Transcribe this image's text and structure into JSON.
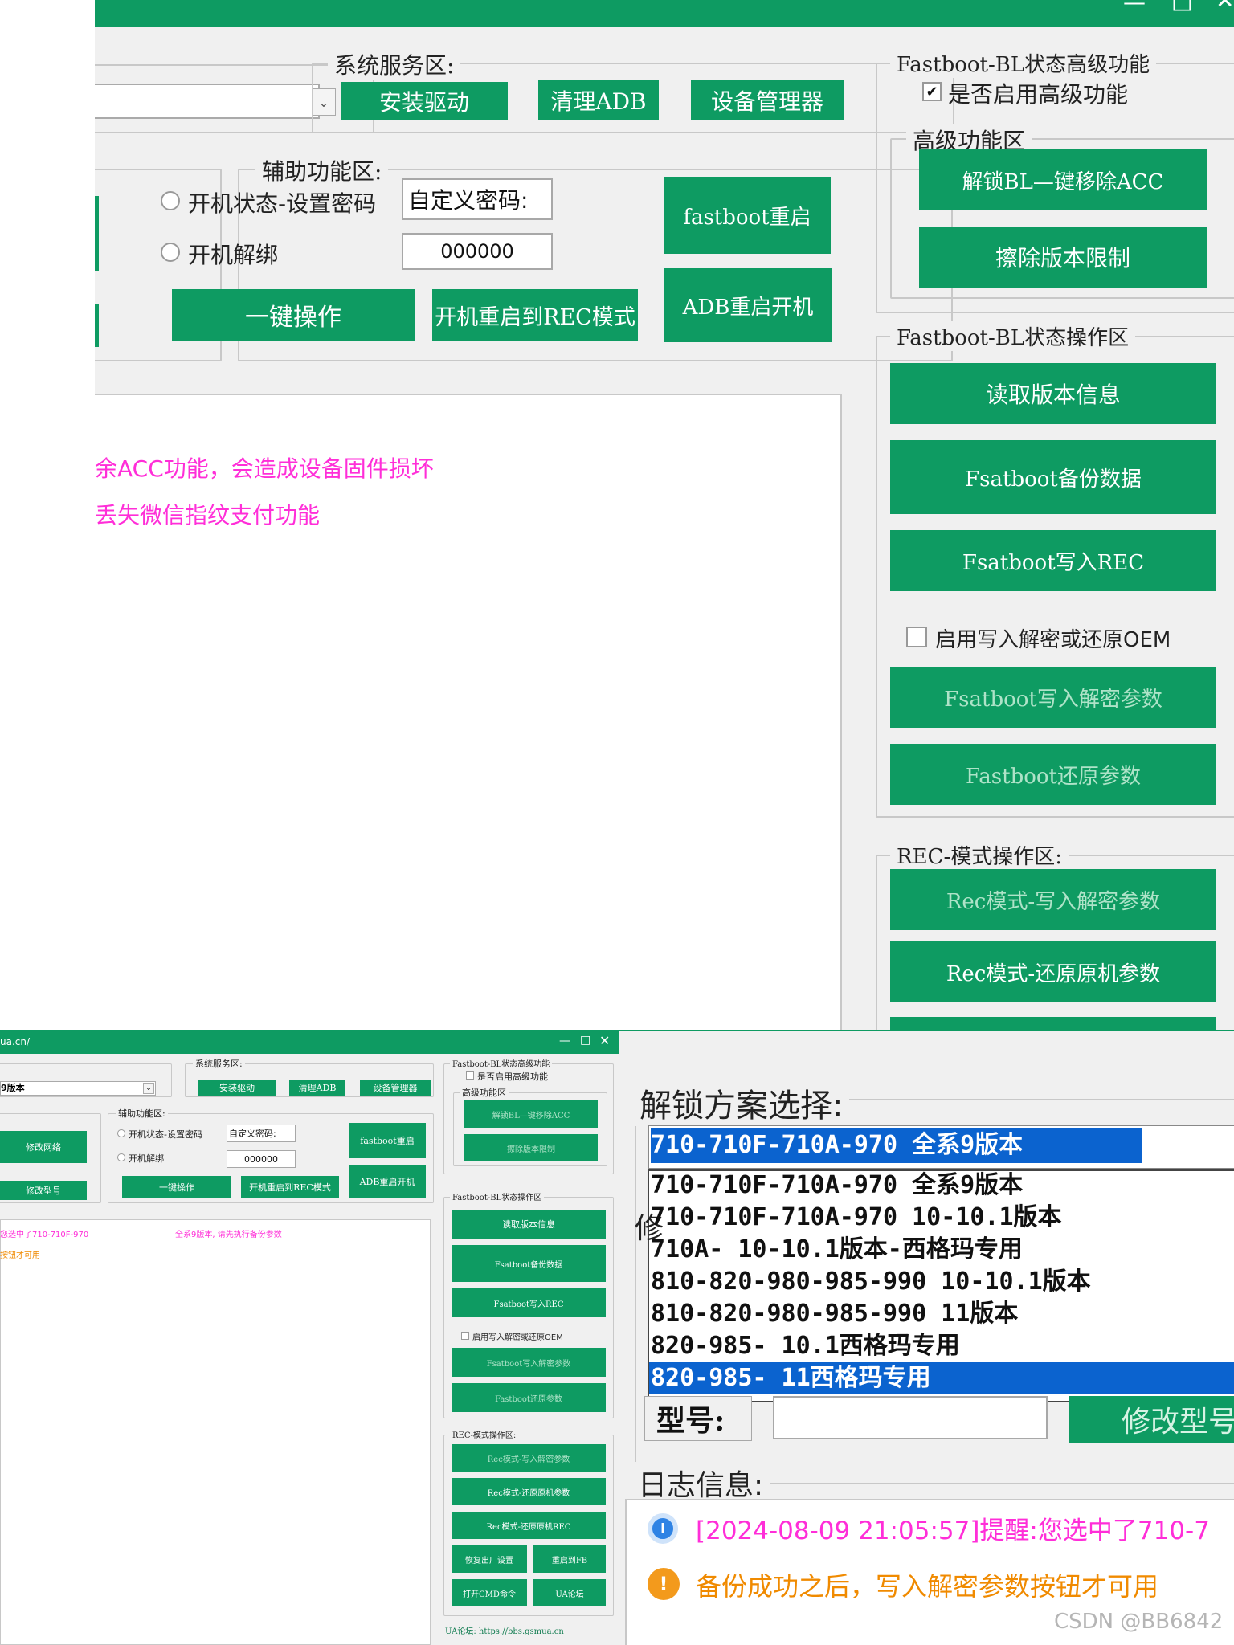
{
  "top": {
    "window_controls": {
      "minimize": "—",
      "maximize": "□",
      "close": "✕"
    },
    "system": {
      "legend": "系统服务区:",
      "install_driver": "安装驱动",
      "clear_adb": "清理ADB",
      "device_manager": "设备管理器"
    },
    "assist": {
      "legend": "辅助功能区:",
      "radio_set_pwd": "开机状态-设置密码",
      "custom_pwd_label": "自定义密码:",
      "radio_unbind": "开机解绑",
      "pwd_value": "000000",
      "one_key": "一键操作",
      "reboot_rec": "开机重启到REC模式",
      "fastboot_reboot": "fastboot重启",
      "adb_reboot": "ADB重启开机"
    },
    "advanced": {
      "legend": "Fastboot-BL状态高级功能",
      "enable_label": "是否启用高级功能",
      "checkmark": "✔",
      "sub_legend": "高级功能区",
      "unlock_acc": "解锁BL—键移除ACC",
      "erase_limit": "擦除版本限制"
    },
    "fastboot_ops": {
      "legend": "Fastboot-BL状态操作区",
      "read_version": "读取版本信息",
      "backup": "Fsatboot备份数据",
      "write_rec": "Fsatboot写入REC",
      "enable_write_label": "启用写入解密或还原OEM",
      "write_decrypt": "Fsatboot写入解密参数",
      "restore_params": "Fastboot还原参数"
    },
    "rec_ops": {
      "legend": "REC-模式操作区:",
      "write_decrypt": "Rec模式-写入解密参数",
      "restore_params": "Rec模式-还原原机参数"
    },
    "log": {
      "line1": "余ACC功能，会造成设备固件损坏",
      "line2": "丢失微信指纹支付功能"
    }
  },
  "small": {
    "url": "ua.cn/",
    "window_controls": {
      "minimize": "—",
      "maximize": "□",
      "close": "✕"
    },
    "version_select": "9版本",
    "modify_network": "修改网络",
    "modify_model": "修改型号",
    "system": {
      "legend": "系统服务区:",
      "install_driver": "安装驱动",
      "clear_adb": "清理ADB",
      "device_manager": "设备管理器"
    },
    "assist": {
      "legend": "辅助功能区:",
      "radio_set_pwd": "开机状态-设置密码",
      "custom_pwd_label": "自定义密码:",
      "radio_unbind": "开机解绑",
      "pwd_value": "000000",
      "one_key": "一键操作",
      "reboot_rec": "开机重启到REC模式",
      "fastboot_reboot": "fastboot重启",
      "adb_reboot": "ADB重启开机"
    },
    "advanced": {
      "legend": "Fastboot-BL状态高级功能",
      "enable_label": "是否启用高级功能",
      "sub_legend": "高级功能区",
      "unlock_acc": "解锁BL—键移除ACC",
      "erase_limit": "擦除版本限制"
    },
    "fastboot_ops": {
      "legend": "Fastboot-BL状态操作区",
      "read_version": "读取版本信息",
      "backup": "Fsatboot备份数据",
      "write_rec": "Fsatboot写入REC",
      "enable_write_label": "启用写入解密或还原OEM",
      "write_decrypt": "Fsatboot写入解密参数",
      "restore_params": "Fastboot还原参数"
    },
    "rec_ops": {
      "legend": "REC-模式操作区:",
      "write_decrypt": "Rec模式-写入解密参数",
      "restore_params": "Rec模式-还原原机参数",
      "restore_rec": "Rec模式-还原原机REC"
    },
    "factory_reset": "恢复出厂设置",
    "reboot_fb": "重启到FB",
    "open_cmd": "打开CMD命令",
    "ua_forum": "UA论坛",
    "forum_link": "UA论坛: https://bbs.gsmua.cn",
    "log": {
      "line1a": "您选中了710-710F-970",
      "line1b": "全系9版本, 请先执行备份参数",
      "line2": "按钮才可用"
    }
  },
  "zoom": {
    "legend": "解锁方案选择:",
    "selected": "710-710F-710A-970        全系9版本",
    "options": [
      "710-710F-710A-970      全系9版本",
      "710-710F-710A-970    10-10.1版本",
      "710A-     10-10.1版本-西格玛专用",
      "810-820-980-985-990 10-10.1版本",
      "810-820-980-985-990       11版本",
      "820-985-          10.1西格玛专用",
      "820-985-            11西格玛专用"
    ],
    "model_label": "型号:",
    "modify_model": "修改型号",
    "stub_char": "修",
    "log_legend": "日志信息:",
    "log_line1": "[2024-08-09 21:05:57]提醒:您选中了710-7",
    "log_line2": "备份成功之后，写入解密参数按钮才可用",
    "info_icon_glyph": "i",
    "warn_icon_glyph": "!"
  },
  "watermark": "CSDN @BB6842"
}
